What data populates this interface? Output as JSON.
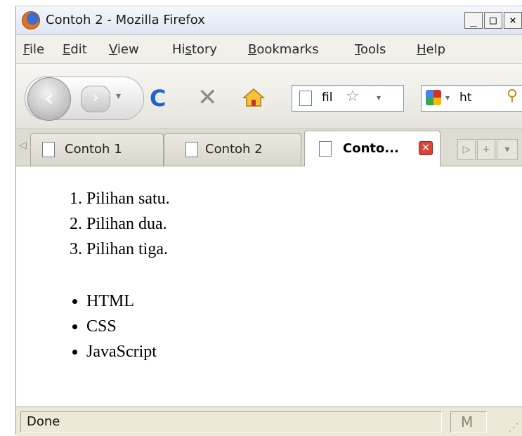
{
  "window": {
    "title": "Contoh 2 - Mozilla Firefox",
    "controls": {
      "minimize": "_",
      "maximize": "□",
      "close": "×"
    }
  },
  "menubar": {
    "items": [
      {
        "label": "File",
        "accel": "F",
        "rest": "ile"
      },
      {
        "label": "Edit",
        "accel": "E",
        "rest": "dit"
      },
      {
        "label": "View",
        "accel": "V",
        "rest": "iew"
      },
      {
        "label": "History",
        "pre": "Hi",
        "accel": "s",
        "rest": "tory"
      },
      {
        "label": "Bookmarks",
        "accel": "B",
        "rest": "ookmarks"
      },
      {
        "label": "Tools",
        "accel": "T",
        "rest": "ools"
      },
      {
        "label": "Help",
        "accel": "H",
        "rest": "elp"
      }
    ]
  },
  "navbar": {
    "back": "‹",
    "forward": "›",
    "history_dropdown": "▾",
    "reload": "C",
    "stop": "✕",
    "url_text": "fil",
    "bookmark_star": "☆",
    "url_dropdown": "▾",
    "search_dropdown": "▾",
    "search_text": "ht",
    "search_icon": "⚲"
  },
  "tabs": [
    {
      "label": "Contoh 1",
      "active": false
    },
    {
      "label": "Contoh 2",
      "active": false
    },
    {
      "label": "Conto...",
      "active": true
    }
  ],
  "tab_controls": {
    "scroll_left": "◁",
    "scroll_right": "▷",
    "new_tab": "+",
    "list_all": "▾",
    "close": "✕"
  },
  "content": {
    "ordered_list": [
      "Pilihan satu.",
      "Pilihan dua.",
      "Pilihan tiga."
    ],
    "unordered_list": [
      "HTML",
      "CSS",
      "JavaScript"
    ]
  },
  "statusbar": {
    "text": "Done",
    "cell_glyph": "M",
    "grip": "⋰"
  },
  "colors": {
    "titlebar": "#dfe6f2",
    "chrome": "#ece9d8",
    "reload_blue": "#1f63d0",
    "tab_close_red": "#d9453a",
    "url_border": "#7f9db9"
  },
  "icons": {
    "app": "firefox-logo-icon",
    "home": "home-icon",
    "page": "page-icon",
    "search_engine": "google-logo-icon"
  }
}
